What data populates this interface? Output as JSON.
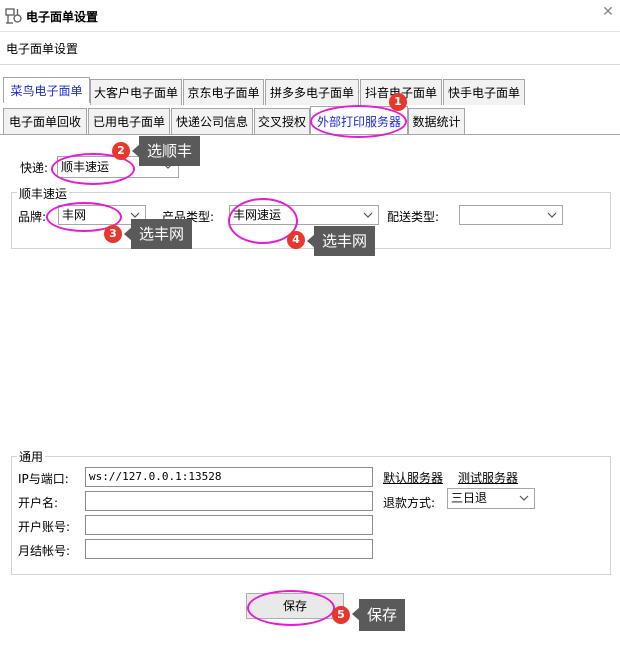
{
  "window": {
    "title": "电子面单设置",
    "close_glyph": "✕"
  },
  "subheader": {
    "text": "电子面单设置"
  },
  "tabs_row1": [
    {
      "label": "菜鸟电子面单"
    },
    {
      "label": "大客户电子面单"
    },
    {
      "label": "京东电子面单"
    },
    {
      "label": "拼多多电子面单"
    },
    {
      "label": "抖音电子面单"
    },
    {
      "label": "快手电子面单"
    }
  ],
  "tabs_row2": [
    {
      "label": "电子面单回收"
    },
    {
      "label": "已用电子面单"
    },
    {
      "label": "快递公司信息"
    },
    {
      "label": "交叉授权"
    },
    {
      "label": "外部打印服务器"
    },
    {
      "label": "数据统计"
    }
  ],
  "express": {
    "label": "快递:",
    "value": "顺丰速运"
  },
  "sf_group": {
    "title": "顺丰速运",
    "brand_label": "品牌:",
    "brand_value": "丰网",
    "product_label": "产品类型:",
    "product_value": "丰网速运",
    "delivery_label": "配送类型:",
    "delivery_value": ""
  },
  "general_group": {
    "title": "通用",
    "ip_label": "IP与端口:",
    "ip_value": "ws://127.0.0.1:13528",
    "default_server_link": "默认服务器",
    "test_server_link": "测试服务器",
    "account_name_label": "开户名:",
    "account_name_value": "",
    "refund_label": "退款方式:",
    "refund_value": "三日退",
    "account_no_label": "开户账号:",
    "account_no_value": "",
    "monthly_label": "月结帐号:",
    "monthly_value": ""
  },
  "save_button": {
    "label": "保存"
  },
  "annotations": {
    "badges": [
      "1",
      "2",
      "3",
      "4",
      "5"
    ],
    "tips": [
      "选顺丰",
      "选丰网",
      "选丰网",
      "保存"
    ],
    "highlight_color": "#e81ad6",
    "badge_color": "#e8372c",
    "active_tab_text_color": "#1a2bd6"
  },
  "icons": {
    "app": "settings-app-icon",
    "close": "close-icon",
    "dropdown": "chevron-down-icon"
  }
}
